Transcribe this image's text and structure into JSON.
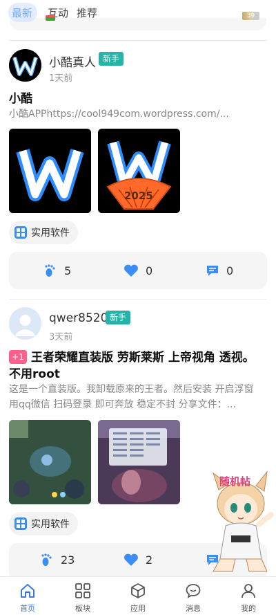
{
  "top_tabs": {
    "latest": "最新",
    "interact": "互动",
    "recommend": "推荐"
  },
  "status": {
    "battery": "39"
  },
  "posts": [
    {
      "username": "小酷真人",
      "badge": "新手",
      "time": "1天前",
      "title": "小酷",
      "desc": "小酷APPhttps://cool949com.wordpress.com/...",
      "images": [
        "W logo",
        "W 2025 logo"
      ],
      "image_caption": "2025",
      "category": "实用软件",
      "stats": {
        "views": "5",
        "likes": "0",
        "comments": "0"
      }
    },
    {
      "username": "qwer8520",
      "badge": "新手",
      "time": "3天前",
      "hot_badge": "+1",
      "title": "王者荣耀直装版 劳斯莱斯 上帝视角 透视。不用root",
      "desc": "这是一个直装版。我卸载原来的王者。然后安装 开启浮窗 用qq微信 扫码登录 即可奔放 稳定不封 分享文件：...",
      "images": [
        "game screenshot",
        "game menu screenshot"
      ],
      "category": "实用软件",
      "stats": {
        "views": "23",
        "likes": "2",
        "comments": ""
      }
    }
  ],
  "floating": {
    "label": "随机帖"
  },
  "bottom_nav": [
    {
      "label": "首页",
      "icon": "home-icon",
      "active": true
    },
    {
      "label": "板块",
      "icon": "grid-icon",
      "active": false
    },
    {
      "label": "应用",
      "icon": "box-icon",
      "active": false
    },
    {
      "label": "消息",
      "icon": "chat-icon",
      "active": false
    },
    {
      "label": "我的",
      "icon": "user-icon",
      "active": false
    }
  ],
  "colors": {
    "accent": "#3a7bd5",
    "badge": "#29b3a8",
    "hot": "#ff5f8a",
    "icon_blue": "#3a8ef6"
  }
}
